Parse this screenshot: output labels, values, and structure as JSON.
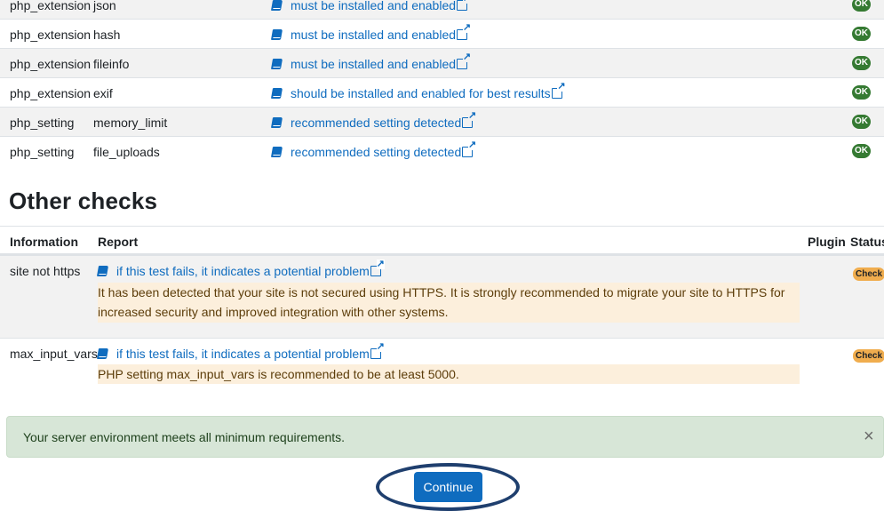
{
  "environment_rows": [
    {
      "type": "php_extension",
      "name": "json",
      "report": "must be installed and enabled",
      "status": "OK"
    },
    {
      "type": "php_extension",
      "name": "hash",
      "report": "must be installed and enabled",
      "status": "OK"
    },
    {
      "type": "php_extension",
      "name": "fileinfo",
      "report": "must be installed and enabled",
      "status": "OK"
    },
    {
      "type": "php_extension",
      "name": "exif",
      "report": "should be installed and enabled for best results",
      "status": "OK"
    },
    {
      "type": "php_setting",
      "name": "memory_limit",
      "report": "recommended setting detected",
      "status": "OK"
    },
    {
      "type": "php_setting",
      "name": "file_uploads",
      "report": "recommended setting detected",
      "status": "OK"
    }
  ],
  "other_checks": {
    "title": "Other checks",
    "headers": {
      "information": "Information",
      "report": "Report",
      "plugin": "Plugin",
      "status": "Status"
    },
    "rows": [
      {
        "information": "site not https",
        "link": "if this test fails, it indicates a potential problem",
        "note": "It has been detected that your site is not secured using HTTPS. It is strongly recommended to migrate your site to HTTPS for increased security and improved integration with other systems.",
        "status": "Check"
      },
      {
        "information": "max_input_vars",
        "link": "if this test fails, it indicates a potential problem",
        "note": "PHP setting max_input_vars is recommended to be at least 5000.",
        "status": "Check"
      }
    ]
  },
  "alert": {
    "message": "Your server environment meets all minimum requirements.",
    "close": "×"
  },
  "continue_label": "Continue",
  "colors": {
    "link": "#0f6cbf",
    "ok": "#357a32",
    "check": "#f0ad4e",
    "alert_bg": "#d7e6d7",
    "note_bg": "#fcefdc"
  }
}
